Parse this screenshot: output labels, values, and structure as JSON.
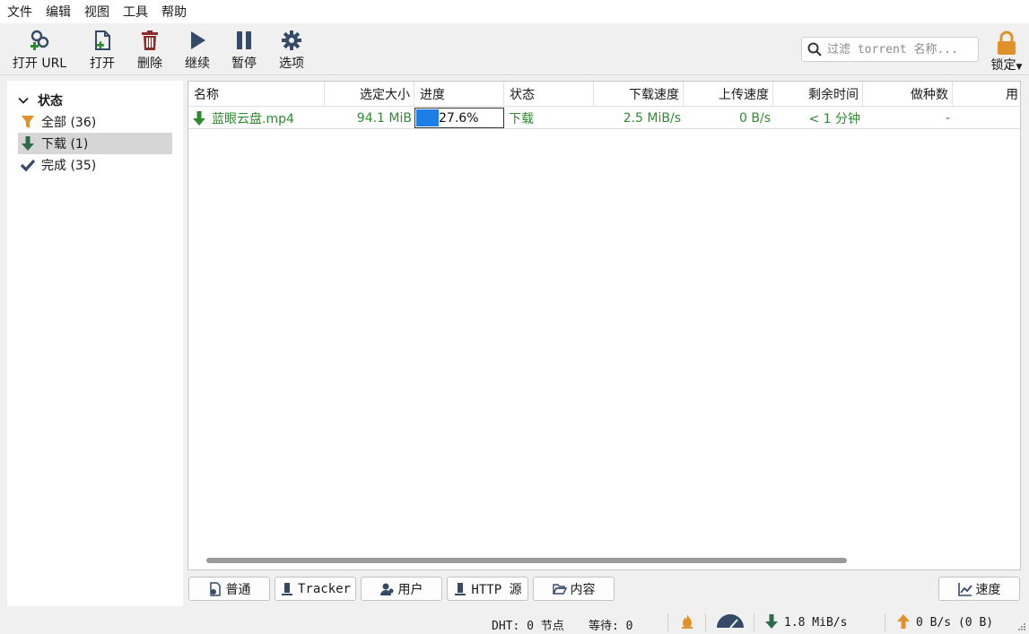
{
  "menu": [
    "文件",
    "编辑",
    "视图",
    "工具",
    "帮助"
  ],
  "toolbar": {
    "open_url": "打开 URL",
    "open": "打开",
    "delete": "删除",
    "resume": "继续",
    "pause": "暂停",
    "options": "选项",
    "lock": "锁定"
  },
  "search": {
    "placeholder": "过滤 torrent 名称..."
  },
  "sidebar": {
    "header": "状态",
    "items": [
      {
        "label": "全部 (36)",
        "icon": "filter-icon"
      },
      {
        "label": "下载 (1)",
        "icon": "download-arrow-icon"
      },
      {
        "label": "完成 (35)",
        "icon": "check-icon"
      }
    ]
  },
  "columns": [
    "名称",
    "选定大小",
    "进度",
    "状态",
    "下载速度",
    "上传速度",
    "剩余时间",
    "做种数",
    "用"
  ],
  "torrents": [
    {
      "name": "蓝眼云盘.mp4",
      "size": "94.1 MiB",
      "progress_text": "27.6%",
      "progress": 0.276,
      "status": "下载",
      "down_speed": "2.5 MiB/s",
      "up_speed": "0 B/s",
      "eta": "< 1 分钟",
      "seeds": "-"
    }
  ],
  "tabs": [
    "普通",
    "Tracker",
    "用户",
    "HTTP 源",
    "内容"
  ],
  "speed_button": "速度",
  "statusbar": {
    "dht": "DHT: 0 节点",
    "waiting": "等待: 0",
    "down": "1.8 MiB/s",
    "up": "0 B/s (0 B)"
  },
  "colors": {
    "accent_blue": "#1e7ee8",
    "downloading_green": "#2e8b2e",
    "icon_dark": "#344a66",
    "delete_red": "#8b2b2b",
    "lock_orange": "#e0922a"
  }
}
